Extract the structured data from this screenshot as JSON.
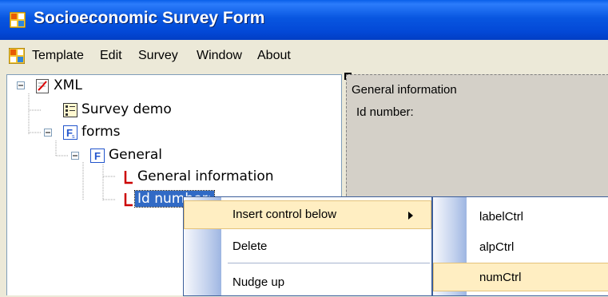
{
  "window": {
    "title": "Socioeconomic Survey Form",
    "icon": "app-grid-icon"
  },
  "menu": {
    "items": [
      "Template",
      "Edit",
      "Survey",
      "Window",
      "About"
    ]
  },
  "tree": {
    "nodes": [
      {
        "label": "XML",
        "icon": "xml-document-icon",
        "expander": "minus"
      },
      {
        "label": "Survey demo",
        "icon": "survey-icon"
      },
      {
        "label": "forms",
        "icon": "forms-icon",
        "expander": "minus"
      },
      {
        "label": "General",
        "icon": "form-f-icon",
        "expander": "minus"
      },
      {
        "label": "General information",
        "icon": "label-l-icon"
      },
      {
        "label": "Id number:",
        "icon": "label-l-icon",
        "selected": true
      }
    ]
  },
  "preview": {
    "section_title": "General information",
    "field_label": "Id number:"
  },
  "context_menu": {
    "items": [
      {
        "label": "Insert control below",
        "has_submenu": true,
        "highlighted": true
      },
      {
        "label": "Delete"
      },
      {
        "label": "Nudge up"
      }
    ]
  },
  "submenu": {
    "items": [
      {
        "label": "labelCtrl"
      },
      {
        "label": "alpCtrl"
      },
      {
        "label": "numCtrl",
        "highlighted": true
      }
    ]
  },
  "colors": {
    "titlebar": "#0348D6",
    "selection": "#316AC5",
    "menu_highlight": "#FFEEC2",
    "node_icon_red": "#CC0000"
  }
}
